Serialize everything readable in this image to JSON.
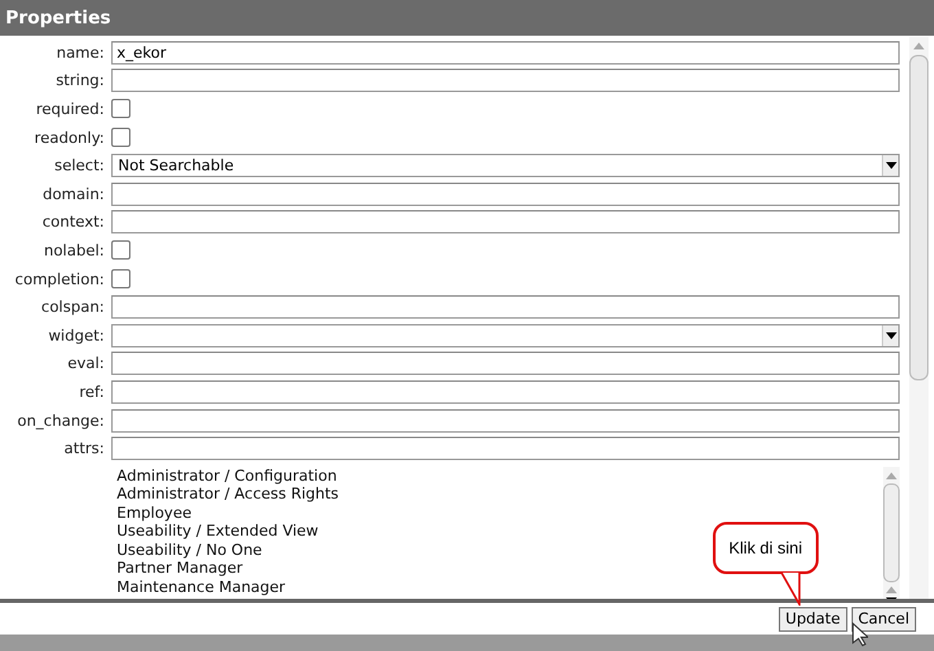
{
  "window": {
    "title": "Properties"
  },
  "fields": [
    {
      "label": "name:",
      "kind": "text",
      "value": "x_ekor"
    },
    {
      "label": "string:",
      "kind": "text"
    },
    {
      "label": "required:",
      "kind": "checkbox",
      "checked": false
    },
    {
      "label": "readonly:",
      "kind": "checkbox",
      "checked": false
    },
    {
      "label": "select:",
      "kind": "select",
      "value": "Not Searchable"
    },
    {
      "label": "domain:",
      "kind": "text"
    },
    {
      "label": "context:",
      "kind": "text"
    },
    {
      "label": "nolabel:",
      "kind": "checkbox",
      "checked": false
    },
    {
      "label": "completion:",
      "kind": "checkbox",
      "checked": false
    },
    {
      "label": "colspan:",
      "kind": "text"
    },
    {
      "label": "widget:",
      "kind": "select"
    },
    {
      "label": "eval:",
      "kind": "text"
    },
    {
      "label": "ref:",
      "kind": "text"
    },
    {
      "label": "on_change:",
      "kind": "text"
    },
    {
      "label": "attrs:",
      "kind": "text"
    }
  ],
  "groups": [
    "Administrator / Configuration",
    "Administrator / Access Rights",
    "Employee",
    "Useability / Extended View",
    "Useability / No One",
    "Partner Manager",
    "Maintenance Manager"
  ],
  "callout": "Klik di sini",
  "buttons": [
    "Update",
    "Cancel"
  ]
}
